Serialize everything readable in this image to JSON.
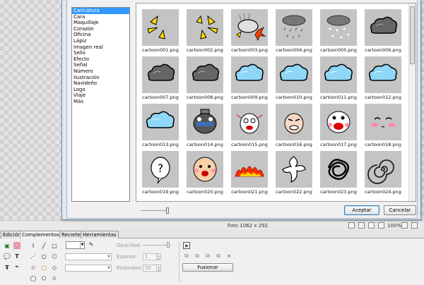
{
  "categories": [
    "Caricatura",
    "Cara",
    "Maquillaje",
    "Corazón",
    "Oficina",
    "Lápiz",
    "Imagen real",
    "Sello",
    "Efecto",
    "Señal",
    "Número",
    "Ilustración",
    "Navideño",
    "Logo",
    "Viaje",
    "Más"
  ],
  "selected_category": "Caricatura",
  "gallery": [
    {
      "file": "cartoon001.png",
      "icon": "yellow-spikes-left-icon"
    },
    {
      "file": "cartoon002.png",
      "icon": "yellow-spikes-right-icon"
    },
    {
      "file": "cartoon003.png",
      "icon": "rock-burst-icon"
    },
    {
      "file": "cartoon004.png",
      "icon": "rain-cloud-icon"
    },
    {
      "file": "cartoon005.png",
      "icon": "snow-cloud-icon"
    },
    {
      "file": "cartoon006.png",
      "icon": "dark-cloud-icon"
    },
    {
      "file": "cartoon007.png",
      "icon": "dark-cloud-icon"
    },
    {
      "file": "cartoon008.png",
      "icon": "dark-cloud-icon"
    },
    {
      "file": "cartoon009.png",
      "icon": "blue-cloud-icon"
    },
    {
      "file": "cartoon010.png",
      "icon": "blue-cloud-icon"
    },
    {
      "file": "cartoon011.png",
      "icon": "blue-cloud-icon"
    },
    {
      "file": "cartoon012.png",
      "icon": "blue-cloud-icon"
    },
    {
      "file": "cartoon013.png",
      "icon": "blue-cloud-icon"
    },
    {
      "file": "cartoon014.png",
      "icon": "robot-face-icon"
    },
    {
      "file": "cartoon015.png",
      "icon": "scared-face-icon"
    },
    {
      "file": "cartoon016.png",
      "icon": "angry-face-icon"
    },
    {
      "file": "cartoon017.png",
      "icon": "shouting-face-icon"
    },
    {
      "file": "cartoon018.png",
      "icon": "blush-face-icon"
    },
    {
      "file": "cartoon019.png",
      "icon": "question-bubble-icon"
    },
    {
      "file": "cartoon020.png",
      "icon": "bald-face-icon"
    },
    {
      "file": "cartoon021.png",
      "icon": "fire-icon"
    },
    {
      "file": "cartoon022.png",
      "icon": "splash-icon"
    },
    {
      "file": "cartoon023.png",
      "icon": "scribble-icon"
    },
    {
      "file": "cartoon024.png",
      "icon": "spiral-icon"
    }
  ],
  "dialog": {
    "accept_label": "Aceptar",
    "cancel_label": "Cancelar"
  },
  "status": {
    "photo": "Foto 1062 x 292",
    "zoom": "100%"
  },
  "tabs": [
    {
      "label": "Edición",
      "active": false
    },
    {
      "label": "Complementos",
      "active": true
    },
    {
      "label": "Recorte",
      "active": false
    },
    {
      "label": "Herramientas",
      "active": false
    }
  ],
  "panel": {
    "opacity_label": "Opacidad",
    "thickness_label": "Espesor",
    "thickness_value": "1",
    "rounded_label": "Redondeo",
    "rounded_value": "50",
    "merge_label": "Fusionar"
  },
  "colors": {
    "accent": "#3399ff",
    "thumb_bg": "#c4c4c4",
    "highlight": "#f7c4cc"
  }
}
